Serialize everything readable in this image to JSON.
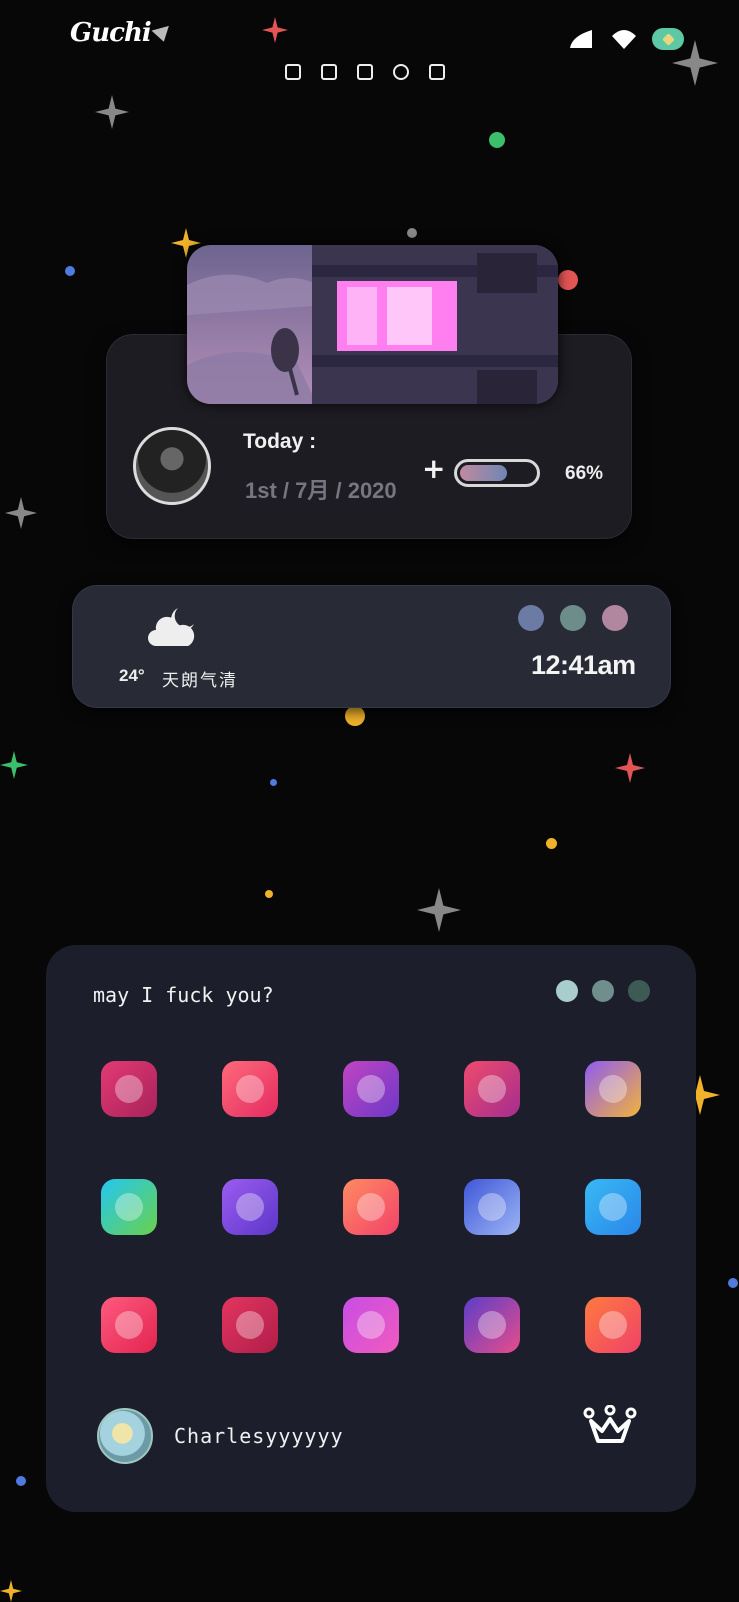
{
  "status_bar": {
    "carrier": "Guchi",
    "icons": [
      "signal-icon",
      "wifi-icon",
      "battery-icon"
    ],
    "notification_icons": [
      "screen-icon",
      "calendar-icon",
      "clipboard-icon",
      "block-icon",
      "speaker-icon"
    ]
  },
  "profile_widget": {
    "today_label": "Today :",
    "date": "1st / 7月 / 2020",
    "plus": "+",
    "progress_fraction": 0.66,
    "progress_text": "66%",
    "colors": {
      "bar_start": "#c08aa0",
      "bar_end": "#6f86b4"
    }
  },
  "weather_widget": {
    "icon": "cloud-moon-icon",
    "temperature": "24°",
    "condition": "天朗气清",
    "time": "12:41am",
    "dot_colors": [
      "#6b7ba4",
      "#6c8d8a",
      "#b0879e"
    ]
  },
  "app_widget": {
    "title": "may I fuck you?",
    "dot_colors": [
      "#a9cdcc",
      "#6f8e8c",
      "#3d5a55"
    ],
    "apps": [
      {
        "name": "camera-flower-app-icon",
        "c1": "#e43a74",
        "c2": "#a8225a"
      },
      {
        "name": "health-heart-app-icon",
        "c1": "#ff6a7a",
        "c2": "#e32b62"
      },
      {
        "name": "clock-app-icon",
        "c1": "#c045c2",
        "c2": "#6d38c8"
      },
      {
        "name": "store-bag-app-icon",
        "c1": "#ef4b6c",
        "c2": "#a42d8f"
      },
      {
        "name": "weather-cloud-app-icon",
        "c1": "#8f5cf1",
        "c2": "#f2b23c"
      },
      {
        "name": "location-pin-app-icon",
        "c1": "#23c7f2",
        "c2": "#6ad14a"
      },
      {
        "name": "camera-app-icon",
        "c1": "#9c5cf0",
        "c2": "#5b37c9"
      },
      {
        "name": "notes-app-icon",
        "c1": "#ff8a62",
        "c2": "#f2426a"
      },
      {
        "name": "gallery-app-icon",
        "c1": "#3f58d8",
        "c2": "#9db4f4"
      },
      {
        "name": "bell-app-icon",
        "c1": "#38b9f5",
        "c2": "#2a86e8"
      },
      {
        "name": "phone-app-icon",
        "c1": "#ff5a7d",
        "c2": "#e22451"
      },
      {
        "name": "mail-app-icon",
        "c1": "#e33560",
        "c2": "#b01e49"
      },
      {
        "name": "messages-app-icon",
        "c1": "#c84de6",
        "c2": "#f05bbd"
      },
      {
        "name": "music-app-icon",
        "c1": "#5b3ec9",
        "c2": "#e84d8a"
      },
      {
        "name": "theme-ball-app-icon",
        "c1": "#ff7a3f",
        "c2": "#ef4169"
      }
    ],
    "username": "Charlesyyyyyy",
    "crown_icon": "crown-icon"
  }
}
